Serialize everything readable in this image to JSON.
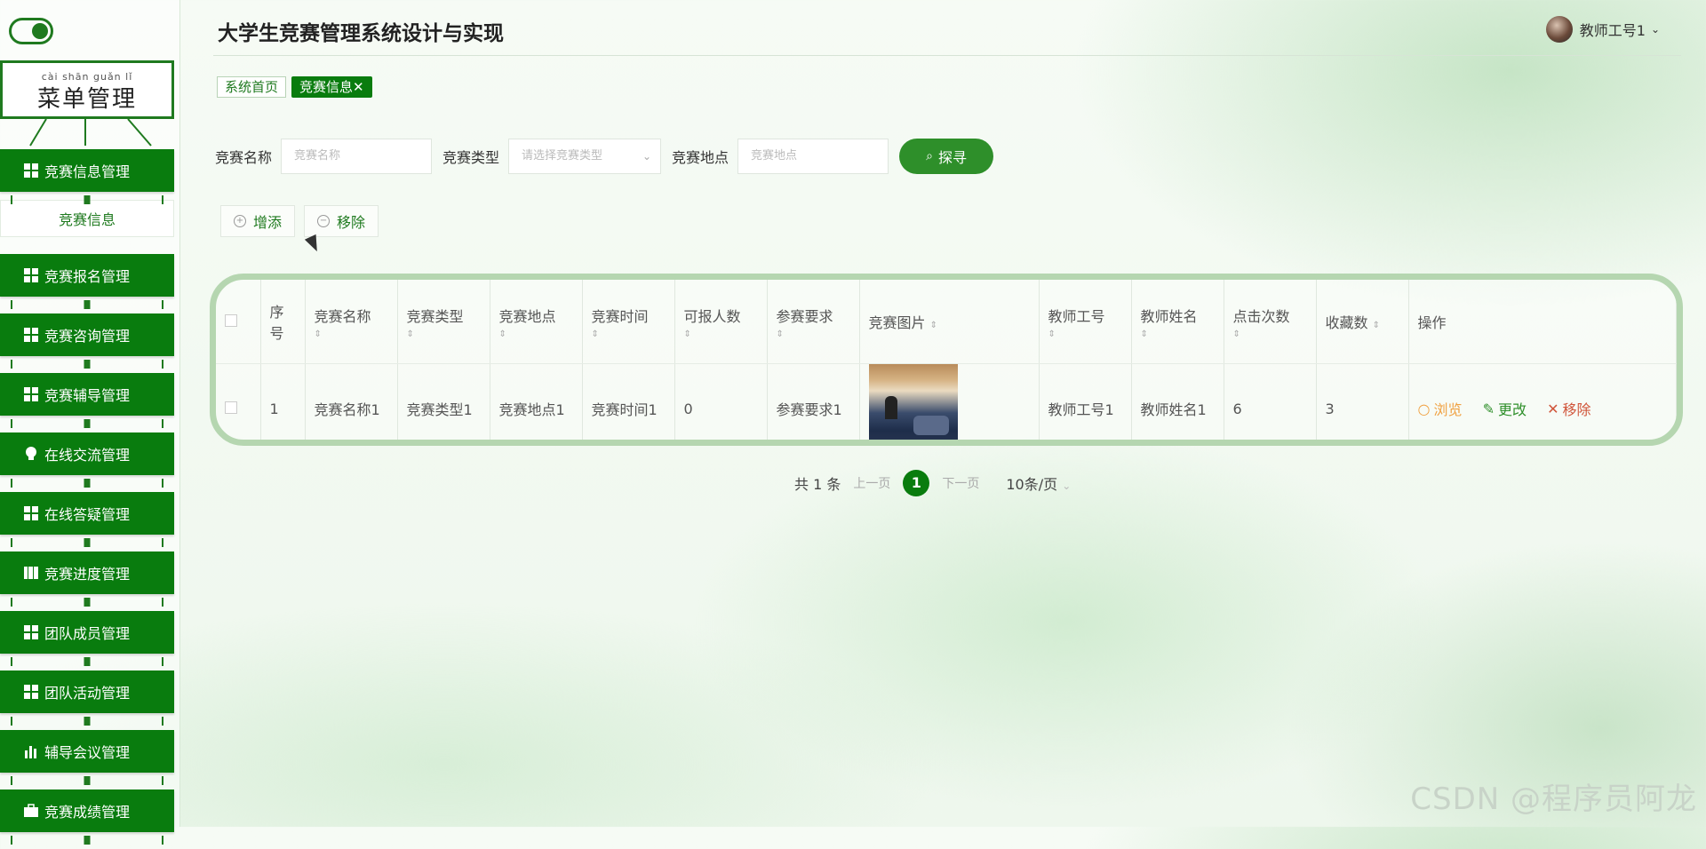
{
  "app": {
    "title": "大学生竞赛管理系统设计与实现"
  },
  "user": {
    "name": "教师工号1"
  },
  "sidebar": {
    "menu_title_ruby": "cài shān guǎn lǐ",
    "menu_title": "菜单管理",
    "items": [
      {
        "label": "竞赛信息管理",
        "icon": "grid-icon"
      },
      {
        "label": "竞赛报名管理",
        "icon": "grid-icon"
      },
      {
        "label": "竞赛咨询管理",
        "icon": "grid-icon"
      },
      {
        "label": "竞赛辅导管理",
        "icon": "grid-icon"
      },
      {
        "label": "在线交流管理",
        "icon": "lightbulb-icon"
      },
      {
        "label": "在线答疑管理",
        "icon": "grid-icon"
      },
      {
        "label": "竞赛进度管理",
        "icon": "book-icon"
      },
      {
        "label": "团队成员管理",
        "icon": "grid-icon"
      },
      {
        "label": "团队活动管理",
        "icon": "grid-icon"
      },
      {
        "label": "辅导会议管理",
        "icon": "bar-chart-icon"
      },
      {
        "label": "竞赛成绩管理",
        "icon": "briefcase-icon"
      }
    ],
    "subitem": "竞赛信息"
  },
  "tabs": [
    {
      "label": "系统首页"
    },
    {
      "label": "竞赛信息",
      "close": "✕"
    }
  ],
  "search": {
    "name_label": "竞赛名称",
    "name_placeholder": "竞赛名称",
    "type_label": "竞赛类型",
    "type_placeholder": "请选择竞赛类型",
    "place_label": "竞赛地点",
    "place_placeholder": "竞赛地点",
    "button": "探寻"
  },
  "actions": {
    "add": "增添",
    "remove": "移除"
  },
  "table": {
    "headers": [
      "序号",
      "竞赛名称",
      "竞赛类型",
      "竞赛地点",
      "竞赛时间",
      "可报人数",
      "参赛要求",
      "竞赛图片",
      "教师工号",
      "教师姓名",
      "点击次数",
      "收藏数",
      "操作"
    ],
    "rows": [
      {
        "index": "1",
        "name": "竞赛名称1",
        "type": "竞赛类型1",
        "place": "竞赛地点1",
        "time": "竞赛时间1",
        "capacity": "0",
        "requirement": "参赛要求1",
        "teacher_id": "教师工号1",
        "teacher_name": "教师姓名1",
        "clicks": "6",
        "favorites": "3",
        "ops": {
          "view": "浏览",
          "edit": "更改",
          "delete": "移除"
        }
      }
    ]
  },
  "pager": {
    "total": "共 1 条",
    "prev": "上一页",
    "current": "1",
    "next": "下一页",
    "size": "10条/页"
  },
  "watermark": "CSDN @程序员阿龙",
  "colors": {
    "primary": "#097c0e",
    "accent": "#2e8f2a",
    "view": "#f0a040",
    "delete": "#d0553a"
  }
}
